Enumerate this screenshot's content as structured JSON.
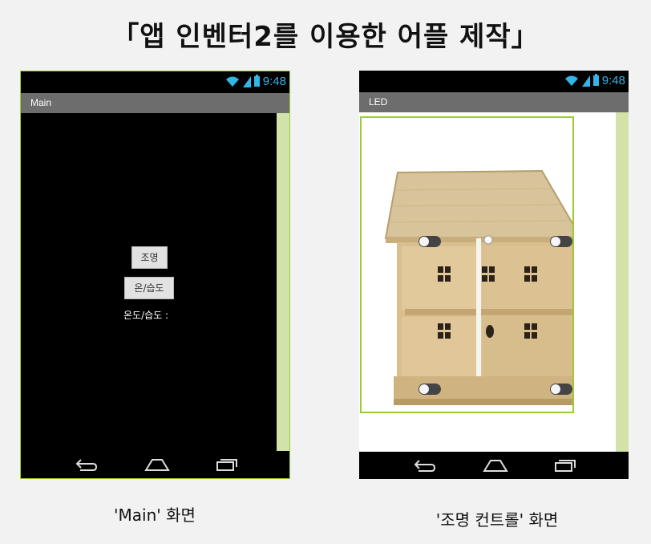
{
  "slide": {
    "title": "「앱 인벤터2를 이용한 어플 제작」"
  },
  "status": {
    "time": "9:48"
  },
  "main_screen": {
    "title": "Main",
    "button_light": "조명",
    "button_temp": "온/습도",
    "temp_label": "온도/습도 :"
  },
  "led_screen": {
    "title": "LED"
  },
  "captions": {
    "main": "'Main' 화면",
    "led": "'조명 컨트롤' 화면"
  },
  "colors": {
    "status_blue": "#33b5e5",
    "frame_green": "#9acd32",
    "strip_green": "#d3e2a8"
  }
}
